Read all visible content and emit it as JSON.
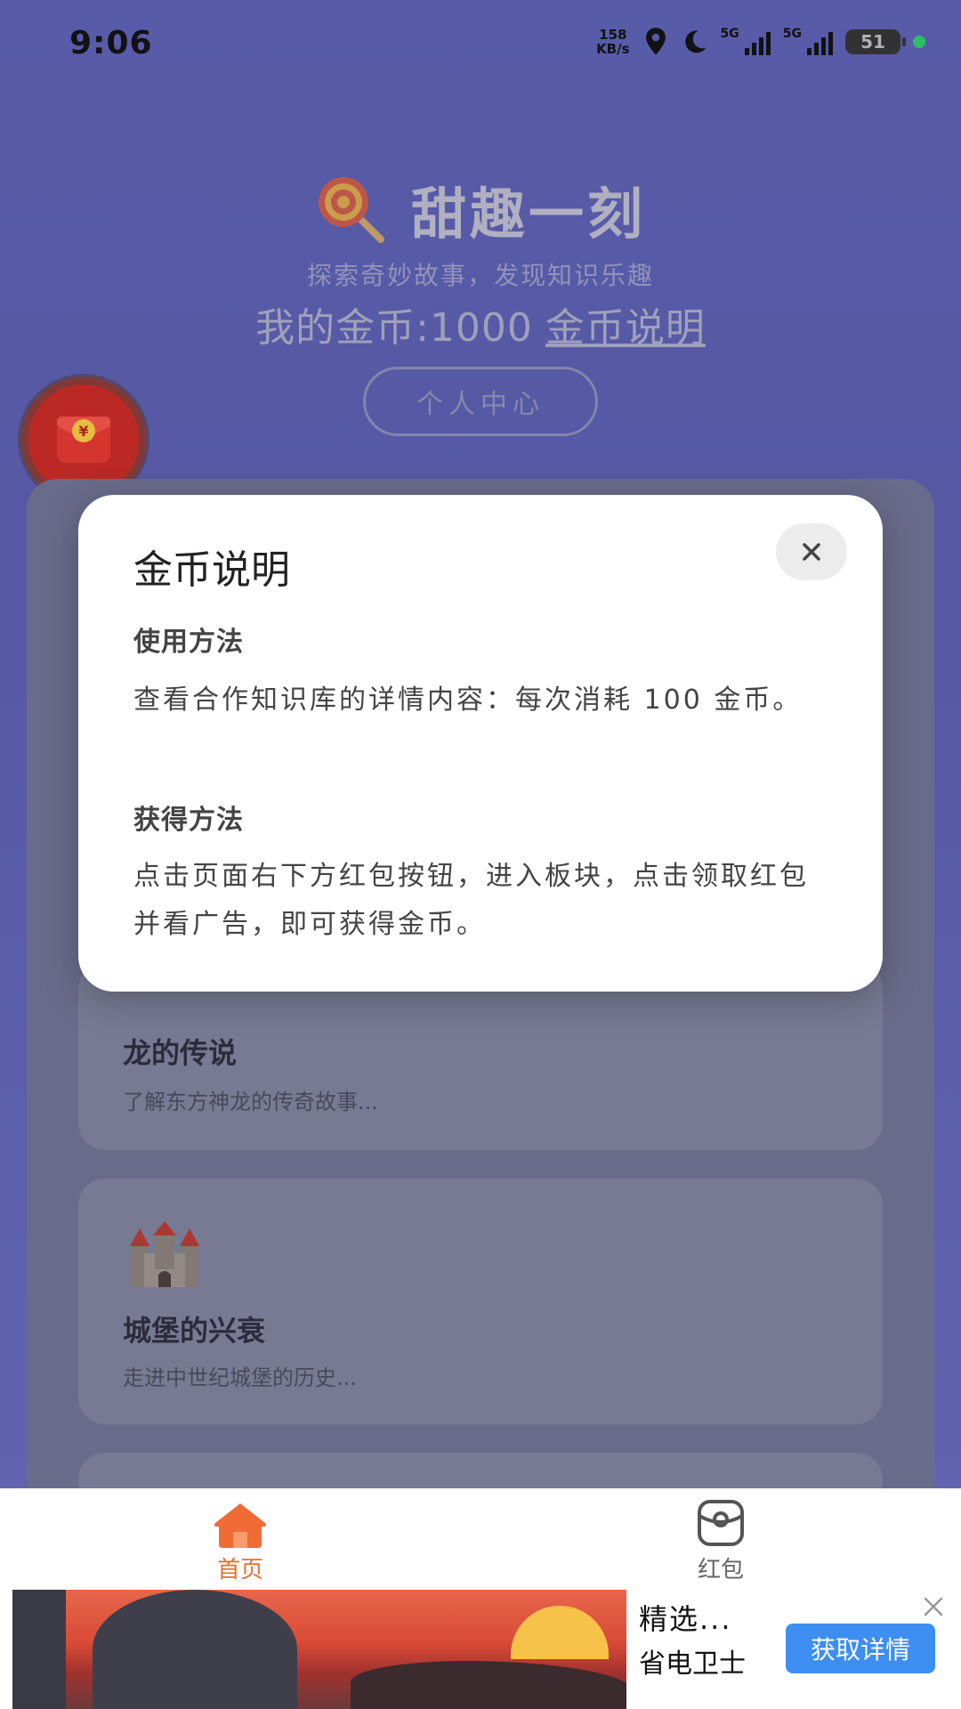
{
  "status_bar": {
    "time": "9:06",
    "net_speed_value": "158",
    "net_speed_unit": "KB/s",
    "network_1": "5G",
    "network_2": "5G",
    "battery": "51"
  },
  "header": {
    "app_title": "甜趣一刻",
    "subtitle": "探索奇妙故事，发现知识乐趣",
    "coins_label": "我的金币:1000",
    "coins_link": "金币说明",
    "profile_button": "个人中心"
  },
  "cards": [
    {
      "title": "龙的传说",
      "desc": "了解东方神龙的传奇故事..."
    },
    {
      "title": "城堡的兴衰",
      "desc": "走进中世纪城堡的历史..."
    }
  ],
  "modal": {
    "title": "金币说明",
    "section_use_title": "使用方法",
    "section_use_text": "查看合作知识库的详情内容：每次消耗 100 金币。",
    "section_earn_title": "获得方法",
    "section_earn_text": "点击页面右下方红包按钮，进入板块，点击领取红包并看广告，即可获得金币。"
  },
  "bottom_nav": {
    "home_label": "首页",
    "redpacket_label": "红包",
    "active_color": "#f06b36"
  },
  "ad": {
    "title": "精选...",
    "brand": "省电卫士",
    "cta": "获取详情"
  },
  "icons": {
    "app_logo": "lollipop-icon",
    "float_button": "red-envelope-icon",
    "modal_close": "close-icon",
    "nav_home": "home-icon",
    "nav_redpacket": "redpacket-icon",
    "card_1": "dragon-icon",
    "card_2": "castle-icon"
  }
}
